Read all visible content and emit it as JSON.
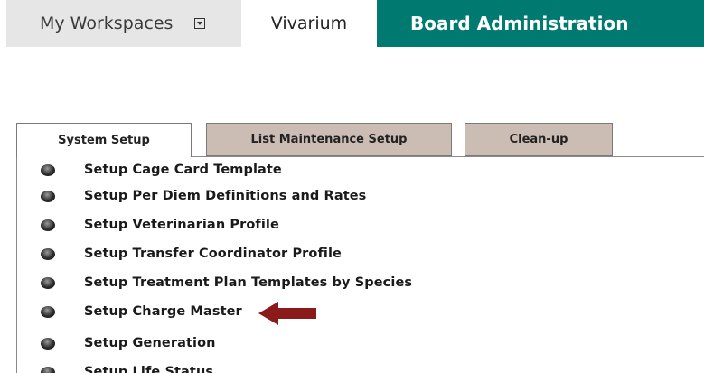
{
  "topnav": {
    "workspaces_label": "My Workspaces",
    "vivarium_label": "Vivarium",
    "admin_label": "Board Administration",
    "accent_color": "#007a70"
  },
  "tabs": [
    {
      "label": "System Setup",
      "active": true
    },
    {
      "label": "List Maintenance Setup",
      "active": false
    },
    {
      "label": "Clean-up",
      "active": false
    }
  ],
  "list": {
    "items": [
      {
        "label": "Setup Cage Card Template"
      },
      {
        "label": "Setup Per Diem Definitions and Rates"
      },
      {
        "label": "Setup Veterinarian Profile"
      },
      {
        "label": "Setup Transfer Coordinator Profile"
      },
      {
        "label": "Setup Treatment Plan Templates by Species"
      },
      {
        "label": "Setup Charge Master"
      },
      {
        "label": "Setup Generation"
      },
      {
        "label": "Setup Life Status"
      }
    ]
  },
  "annotation": {
    "arrow_color": "#8b1a1a",
    "points_to": "Setup Charge Master"
  }
}
